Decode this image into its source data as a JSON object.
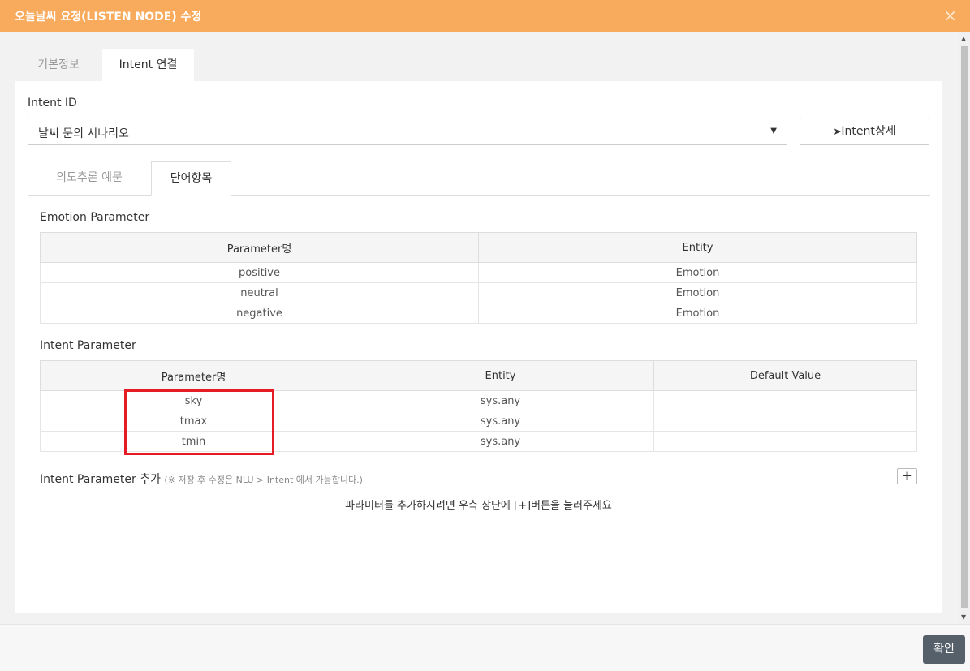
{
  "dialog": {
    "title": "오늘날씨 요청(LISTEN NODE) 수정",
    "close_icon": "×"
  },
  "outer_tabs": [
    {
      "label": "기본정보"
    },
    {
      "label": "Intent 연결"
    }
  ],
  "intent_id": {
    "label": "Intent ID",
    "selected": "날씨 문의 시나리오",
    "detail_button": "Intent상세"
  },
  "inner_tabs": [
    {
      "label": "의도추론 예문"
    },
    {
      "label": "단어항목"
    }
  ],
  "emotion": {
    "title": "Emotion Parameter",
    "headers": [
      "Parameter명",
      "Entity"
    ],
    "rows": [
      {
        "param": "positive",
        "entity": "Emotion"
      },
      {
        "param": "neutral",
        "entity": "Emotion"
      },
      {
        "param": "negative",
        "entity": "Emotion"
      }
    ]
  },
  "intent_params": {
    "title": "Intent Parameter",
    "headers": [
      "Parameter명",
      "Entity",
      "Default Value"
    ],
    "rows": [
      {
        "param": "sky",
        "entity": "sys.any",
        "default": ""
      },
      {
        "param": "tmax",
        "entity": "sys.any",
        "default": ""
      },
      {
        "param": "tmin",
        "entity": "sys.any",
        "default": ""
      }
    ]
  },
  "add_param": {
    "title": "Intent Parameter 추가",
    "note": "(※ 저장 후 수정은 NLU > Intent 에서 가능합니다.)",
    "plus": "+",
    "hint": "파라미터를 추가하시려면 우측 상단에 [+]버튼을 눌러주세요"
  },
  "footer": {
    "ok_button": "확인"
  },
  "colors": {
    "titlebar": "#f8ab5d",
    "highlight": "#e51c23",
    "ok_button": "#56606b"
  }
}
